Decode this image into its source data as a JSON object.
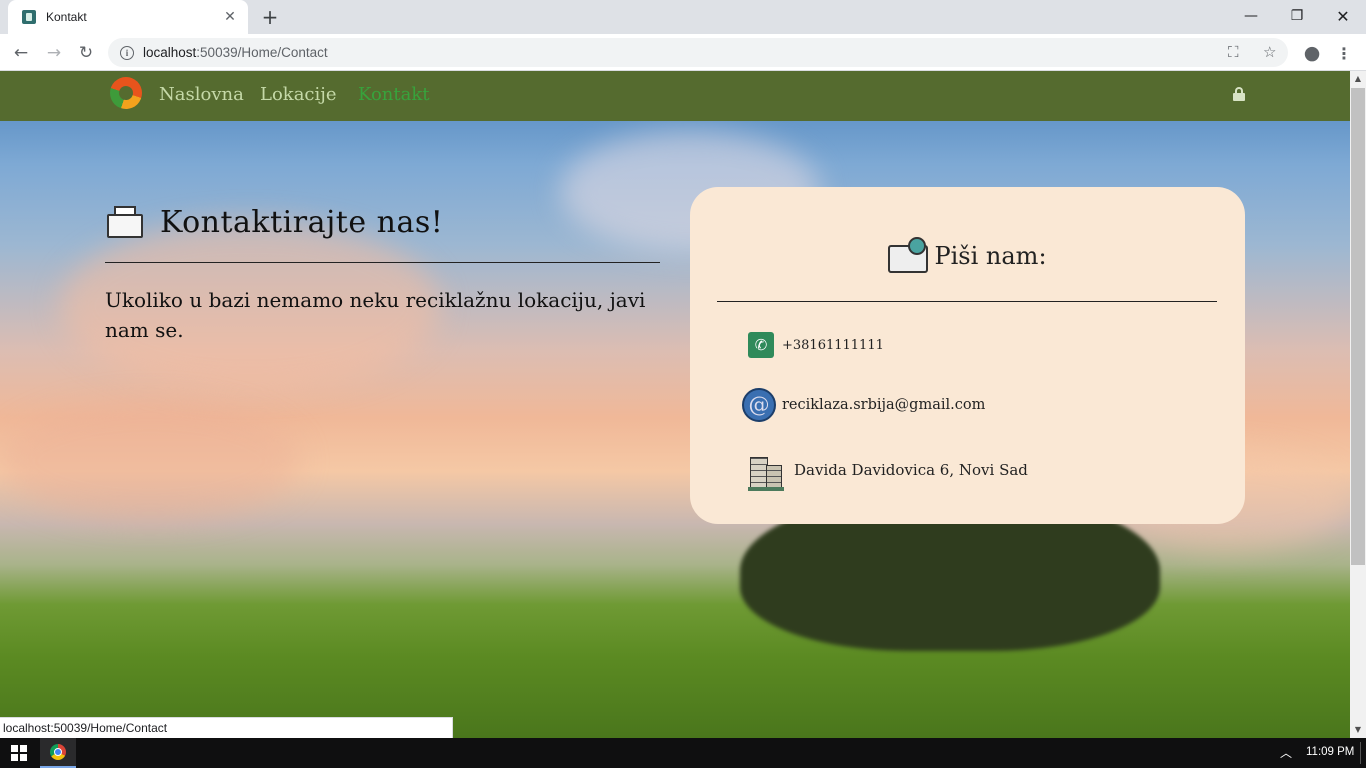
{
  "browser": {
    "tab_title": "Kontakt",
    "url_host": "localhost",
    "url_rest": ":50039/Home/Contact",
    "status_url": "localhost:50039/Home/Contact"
  },
  "nav": {
    "links": [
      "Naslovna",
      "Lokacije",
      "Kontakt"
    ],
    "active_index": 2
  },
  "left": {
    "heading": "Kontaktirajte nas!",
    "text": "Ukoliko u bazi nemamo neku reciklažnu lokaciju, javi nam se."
  },
  "card": {
    "heading": "Piši nam:",
    "phone": "+38161111111",
    "email": "reciklaza.srbija@gmail.com",
    "address": "Davida Davidovica 6, Novi Sad"
  },
  "taskbar": {
    "time": "11:09 PM"
  },
  "colors": {
    "navbar": "#556b2f",
    "card": "#fae8d5",
    "active_link": "#37a33c"
  }
}
